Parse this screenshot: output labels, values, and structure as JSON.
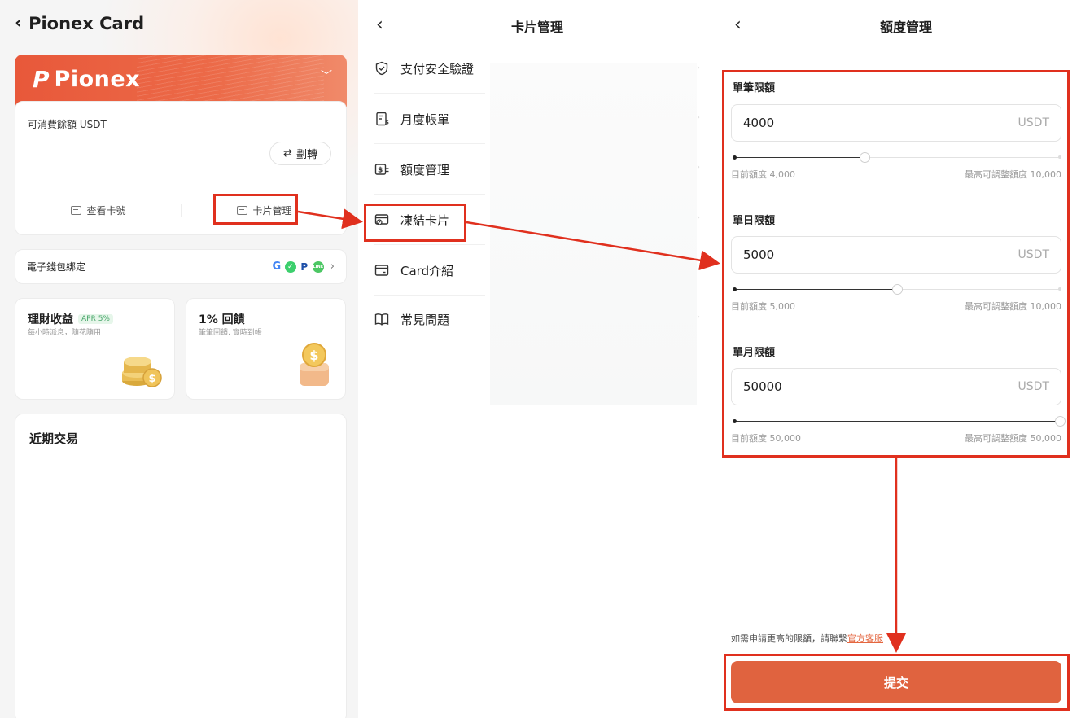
{
  "panel1": {
    "back_icon": "chevron-left-icon",
    "title": "Pionex Card",
    "card": {
      "brand": "Pionex",
      "balance_label": "可消費餘額 USDT",
      "transfer_label": "劃轉",
      "view_card_number": "查看卡號",
      "card_management": "卡片管理"
    },
    "wallet": {
      "label": "電子錢包綁定",
      "icons": [
        "apple-pay-icon",
        "google-pay-icon",
        "samsung-pay-icon",
        "paypal-icon",
        "line-pay-icon"
      ],
      "line_text": "LINE"
    },
    "promo_earn": {
      "title": "理財收益",
      "badge": "APR 5%",
      "subtitle": "每小時派息，隨花隨用"
    },
    "promo_cashback": {
      "title": "1% 回饋",
      "subtitle": "筆筆回饋, 實時到帳"
    },
    "recent": {
      "title": "近期交易"
    }
  },
  "panel2": {
    "title": "卡片管理",
    "menu": [
      {
        "label": "支付安全驗證",
        "icon": "shield-check-icon"
      },
      {
        "label": "月度帳單",
        "icon": "bill-icon"
      },
      {
        "label": "額度管理",
        "icon": "limit-icon"
      },
      {
        "label": "凍結卡片",
        "icon": "freeze-card-icon"
      },
      {
        "label": "Card介紹",
        "icon": "card-icon"
      },
      {
        "label": "常見問題",
        "icon": "book-icon"
      }
    ]
  },
  "panel3": {
    "title": "額度管理",
    "limits": [
      {
        "label": "單筆限額",
        "value": "4000",
        "unit": "USDT",
        "current": "目前額度 4,000",
        "max": "最高可調整額度 10,000",
        "level": 0.4
      },
      {
        "label": "單日限額",
        "value": "5000",
        "unit": "USDT",
        "current": "目前額度 5,000",
        "max": "最高可調整額度 10,000",
        "level": 0.5
      },
      {
        "label": "單月限額",
        "value": "50000",
        "unit": "USDT",
        "current": "目前額度 50,000",
        "max": "最高可調整額度 50,000",
        "level": 1.0
      }
    ],
    "note_prefix": "如需申請更高的限額，請聯繫",
    "note_link": "官方客服",
    "submit": "提交"
  },
  "colors": {
    "accent": "#e0633f",
    "highlight": "#e0301e",
    "brand_orange": "#e8583a"
  }
}
